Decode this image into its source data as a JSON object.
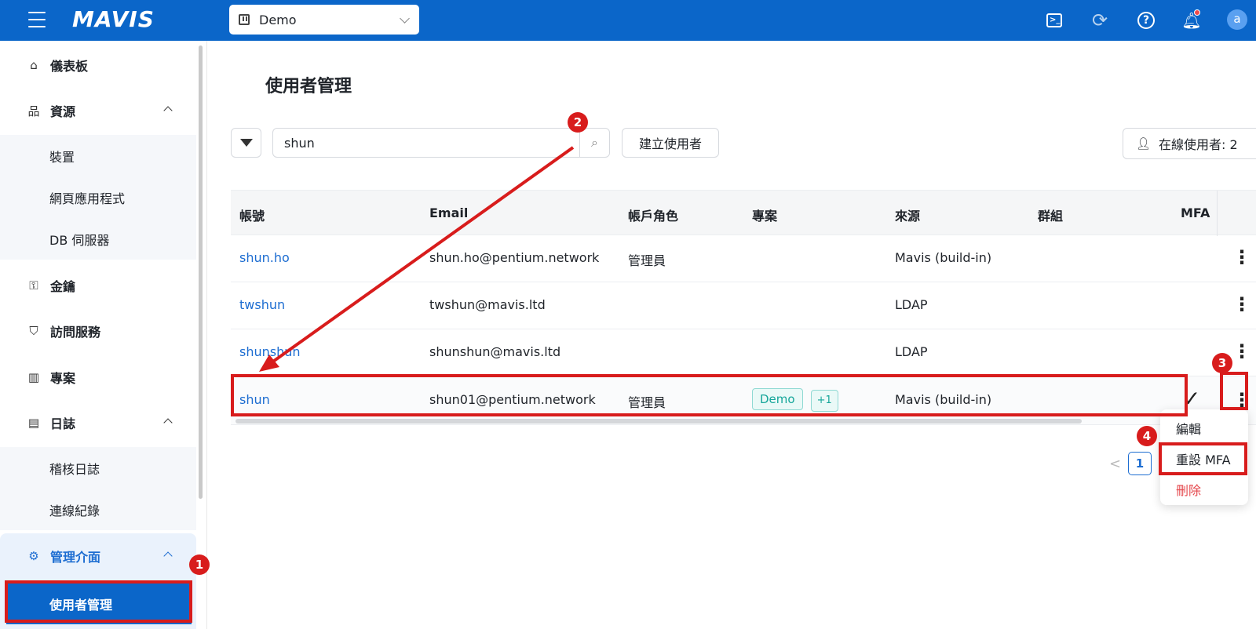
{
  "app": {
    "logo": "MAVIS"
  },
  "topbar": {
    "project": "Demo",
    "avatar": "a"
  },
  "sidebar": {
    "items": [
      {
        "label": "儀表板",
        "icon": "home-icon"
      },
      {
        "label": "資源",
        "icon": "sitemap-icon",
        "expanded": true,
        "children": [
          "裝置",
          "網頁應用程式",
          "DB 伺服器"
        ]
      },
      {
        "label": "金鑰",
        "icon": "key-icon"
      },
      {
        "label": "訪問服務",
        "icon": "shield-icon"
      },
      {
        "label": "專案",
        "icon": "project-icon"
      },
      {
        "label": "日誌",
        "icon": "log-icon",
        "expanded": true,
        "children": [
          "稽核日誌",
          "連線紀錄"
        ]
      },
      {
        "label": "管理介面",
        "icon": "gear-icon",
        "expanded": true,
        "active": true,
        "children": [
          "使用者管理"
        ]
      }
    ]
  },
  "page": {
    "title": "使用者管理",
    "search_value": "shun",
    "create_button": "建立使用者",
    "online_users_label": "在線使用者: 2"
  },
  "table": {
    "headers": [
      "帳號",
      "Email",
      "帳戶角色",
      "專案",
      "來源",
      "群組",
      "MFA"
    ],
    "rows": [
      {
        "account": "shun.ho",
        "email": "shun.ho@pentium.network",
        "role": "管理員",
        "projects": [],
        "source": "Mavis (build-in)",
        "group": "",
        "mfa": false
      },
      {
        "account": "twshun",
        "email": "twshun@mavis.ltd",
        "role": "",
        "projects": [],
        "source": "LDAP",
        "group": "",
        "mfa": false
      },
      {
        "account": "shunshun",
        "email": "shunshun@mavis.ltd",
        "role": "",
        "projects": [],
        "source": "LDAP",
        "group": "",
        "mfa": false
      },
      {
        "account": "shun",
        "email": "shun01@pentium.network",
        "role": "管理員",
        "projects": [
          "Demo",
          "+1"
        ],
        "source": "Mavis (build-in)",
        "group": "",
        "mfa": true
      }
    ]
  },
  "row_menu": {
    "items": [
      "編輯",
      "重設 MFA",
      "刪除"
    ]
  },
  "pagination": {
    "current": "1"
  },
  "annotations": {
    "steps": [
      "1",
      "2",
      "3",
      "4"
    ],
    "color": "#d81c1c"
  },
  "colors": {
    "brand": "#0b66c9",
    "link": "#1d6dd1",
    "tag": "#15a69a",
    "danger": "#e5484d"
  }
}
